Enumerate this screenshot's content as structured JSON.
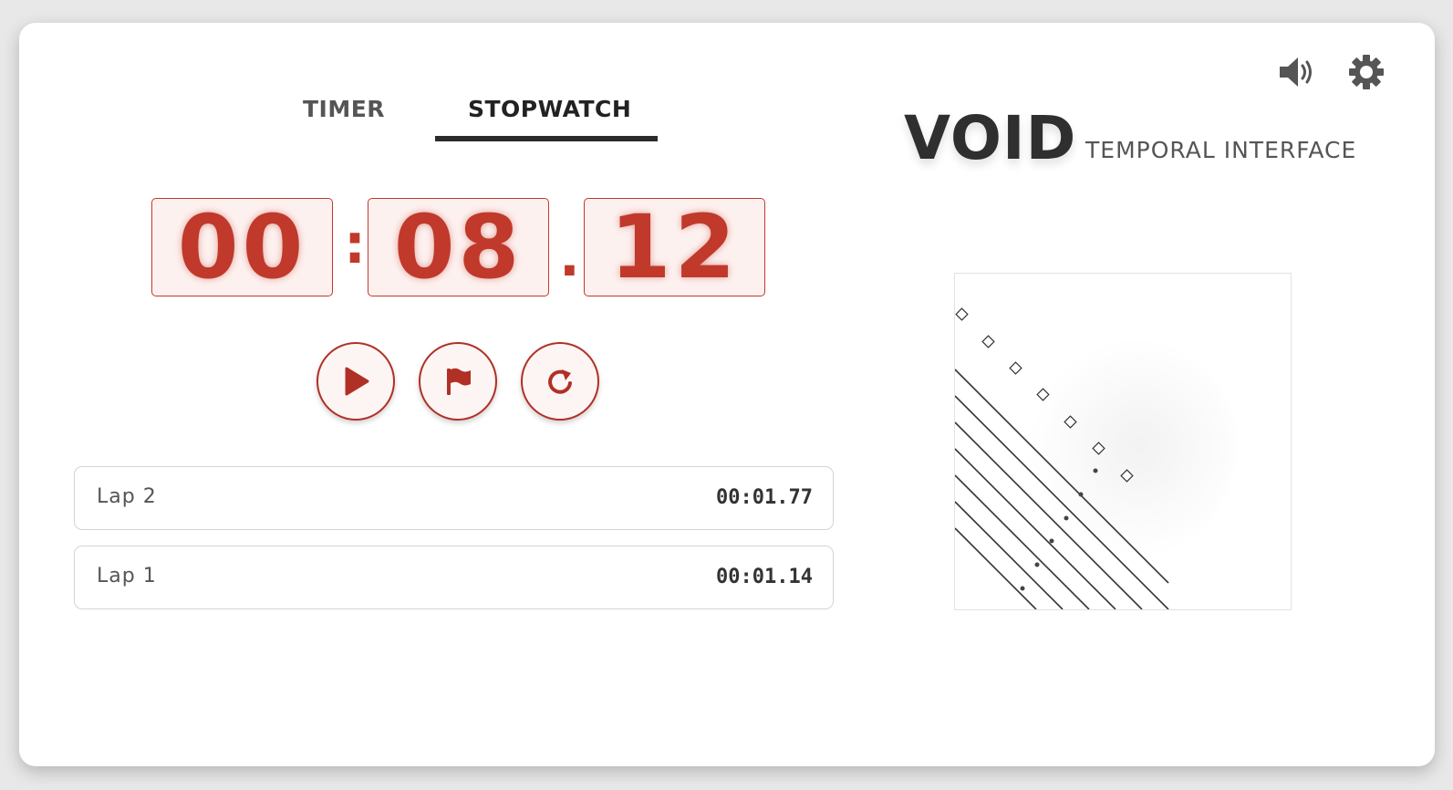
{
  "tabs": {
    "timer": "TIMER",
    "stopwatch": "STOPWATCH",
    "active": "STOPWATCH"
  },
  "header": {
    "brand": "VOID",
    "subtitle": "TEMPORAL INTERFACE"
  },
  "icons": {
    "sound": "speaker-icon",
    "settings": "gear-icon",
    "start": "play-icon",
    "lap": "flag-icon",
    "reset": "reset-icon"
  },
  "display": {
    "minutes": "00",
    "seconds": "08",
    "centiseconds": "12",
    "separator_colon": ":",
    "separator_dot": "."
  },
  "laps": [
    {
      "label": "Lap 2",
      "time": "00:01.77"
    },
    {
      "label": "Lap 1",
      "time": "00:01.14"
    }
  ],
  "colors": {
    "accent": "#c0392b",
    "digit_bg": "#fdf1ef",
    "dark": "#2b2b2b"
  }
}
